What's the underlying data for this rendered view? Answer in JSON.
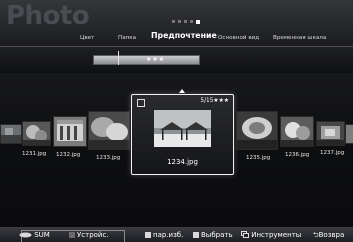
{
  "header": {
    "app_title": "Photo",
    "tabs": [
      {
        "label": "Цвет",
        "active": false
      },
      {
        "label": "Папка",
        "active": false
      },
      {
        "label": "Предпочтение",
        "active": true
      },
      {
        "label": "Основной вид",
        "active": false
      },
      {
        "label": "Временная шкала",
        "active": false
      }
    ],
    "sort_bar_text": "★★★",
    "page_dots": 5,
    "page_dot_active": 4
  },
  "thumbnails": [
    {
      "label": "1231.jpg"
    },
    {
      "label": "1232.jpg"
    },
    {
      "label": "1233.jpg"
    },
    {
      "label": "1235.jpg"
    },
    {
      "label": "1236.jpg"
    },
    {
      "label": "1237.jpg"
    }
  ],
  "focused": {
    "rating_text": "5/15★★★",
    "filename": "1234.jpg"
  },
  "bottom_bar": {
    "sum_label": "SUM",
    "device_label": "Устройс.",
    "select_page_label": "пар.изб.",
    "select_label": "Выбрать",
    "tools_label": "Инструменты",
    "return_label": "Возвра"
  },
  "colors": {
    "accent_text": "#ffffff",
    "tab_text": "#d8d8d8",
    "background": "#0e0f11"
  }
}
